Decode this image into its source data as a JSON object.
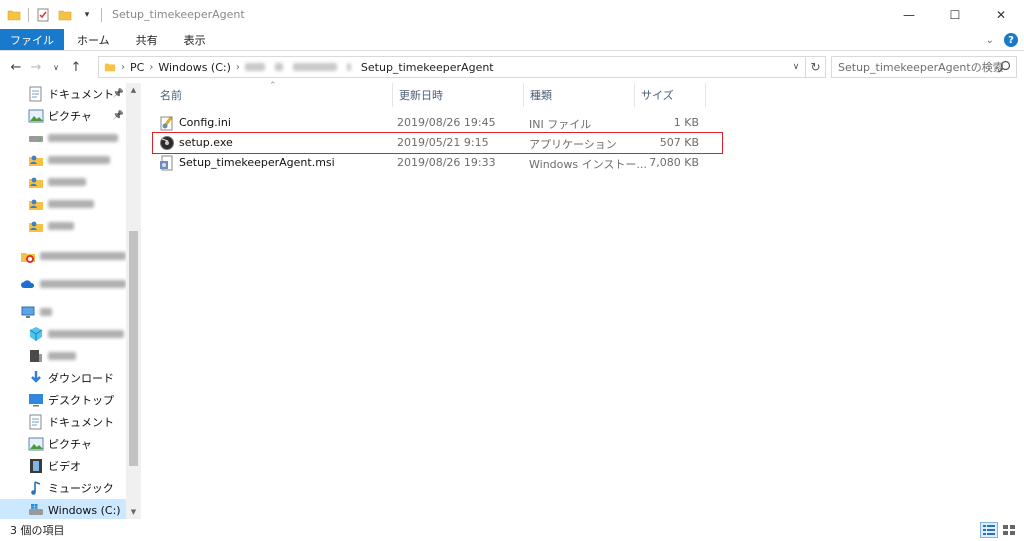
{
  "window": {
    "title": "Setup_timekeeperAgent",
    "controls": {
      "minimize": "—",
      "maximize": "☐",
      "close": "✕"
    }
  },
  "ribbon": {
    "tabs": [
      "ファイル",
      "ホーム",
      "共有",
      "表示"
    ],
    "expand_icon": "chevron-down",
    "help": "?"
  },
  "address": {
    "segments": [
      "PC",
      "Windows (C:)",
      "Setup_timekeeperAgent"
    ],
    "search_placeholder": "Setup_timekeeperAgentの検索"
  },
  "nav": {
    "items": [
      {
        "label": "ドキュメント",
        "icon": "documents-icon",
        "pinned": true
      },
      {
        "label": "ピクチャ",
        "icon": "pictures-icon",
        "pinned": true
      },
      {
        "label": "",
        "icon": "drive-icon",
        "redacted": true
      },
      {
        "label": "",
        "icon": "user-folder-icon",
        "redacted": true
      },
      {
        "label": "",
        "icon": "user-folder-icon",
        "redacted": true
      },
      {
        "label": "",
        "icon": "user-folder-icon",
        "redacted": true
      },
      {
        "label": "",
        "icon": "user-folder-icon",
        "redacted": true
      },
      {
        "label": "",
        "icon": "creative-cloud-icon",
        "redacted": true
      },
      {
        "label": "",
        "icon": "onedrive-icon",
        "redacted": true
      },
      {
        "label": "",
        "icon": "pc-icon",
        "redacted": true
      },
      {
        "label": "",
        "icon": "3d-objects-icon",
        "redacted": true
      },
      {
        "label": "",
        "icon": "device-icon",
        "redacted": true
      },
      {
        "label": "ダウンロード",
        "icon": "downloads-icon"
      },
      {
        "label": "デスクトップ",
        "icon": "desktop-icon"
      },
      {
        "label": "ドキュメント",
        "icon": "documents-icon"
      },
      {
        "label": "ピクチャ",
        "icon": "pictures-icon"
      },
      {
        "label": "ビデオ",
        "icon": "videos-icon"
      },
      {
        "label": "ミュージック",
        "icon": "music-icon"
      },
      {
        "label": "Windows (C:)",
        "icon": "windows-drive-icon",
        "selected": true
      }
    ]
  },
  "columns": {
    "name": "名前",
    "modified": "更新日時",
    "type": "種類",
    "size": "サイズ"
  },
  "files": [
    {
      "name": "Config.ini",
      "modified": "2019/08/26 19:45",
      "type": "INI ファイル",
      "size": "1 KB",
      "icon": "ini-file-icon"
    },
    {
      "name": "setup.exe",
      "modified": "2019/05/21 9:15",
      "type": "アプリケーション",
      "size": "507 KB",
      "icon": "setup-exe-icon",
      "highlighted": true
    },
    {
      "name": "Setup_timekeeperAgent.msi",
      "modified": "2019/08/26 19:33",
      "type": "Windows インストー...",
      "size": "7,080 KB",
      "icon": "msi-file-icon"
    }
  ],
  "status": {
    "item_count": "3 個の項目"
  },
  "colors": {
    "accent": "#1979ca",
    "highlight_box": "#e0232a",
    "selected_bg": "#cce8ff",
    "header_text": "#4c607a"
  }
}
